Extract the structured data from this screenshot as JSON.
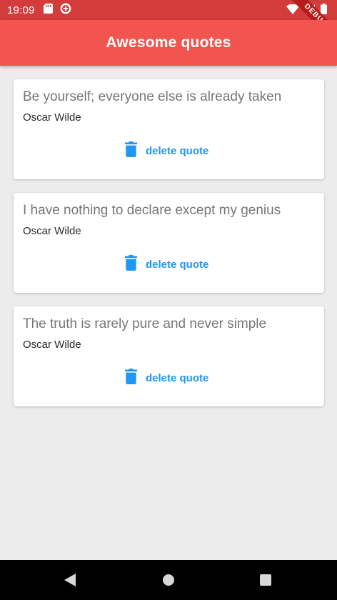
{
  "status_bar": {
    "time": "19:09",
    "debug_banner": "DEBUG",
    "icons": [
      "sd-card-icon",
      "data-saver-icon",
      "wifi-icon",
      "signal-icon",
      "battery-icon"
    ]
  },
  "app_bar": {
    "title": "Awesome quotes",
    "color": "#f25450"
  },
  "quotes": [
    {
      "text": "Be yourself; everyone else is already taken",
      "author": "Oscar Wilde",
      "action_label": "delete quote"
    },
    {
      "text": "I have nothing to declare except my genius",
      "author": "Oscar Wilde",
      "action_label": "delete quote"
    },
    {
      "text": "The truth is rarely pure and never simple",
      "author": "Oscar Wilde",
      "action_label": "delete quote"
    }
  ],
  "accent_color": "#2196f3",
  "nav_bar": {
    "buttons": [
      "back-icon",
      "home-icon",
      "recents-icon"
    ]
  }
}
